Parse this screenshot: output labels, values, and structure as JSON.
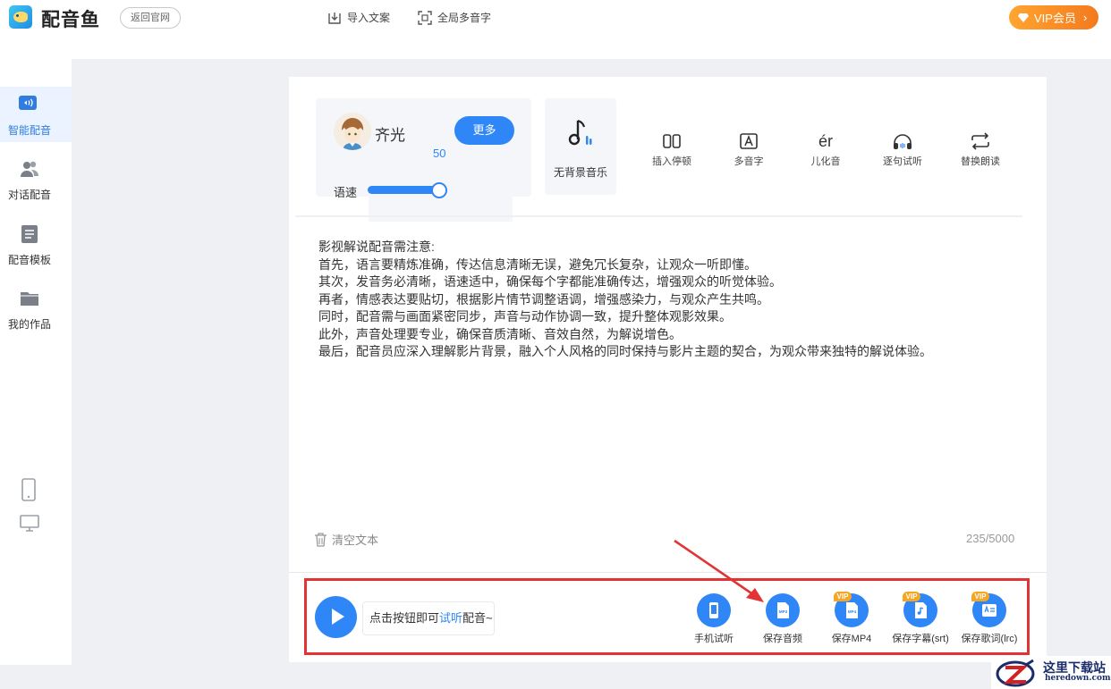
{
  "app": {
    "name": "配音鱼",
    "back_label": "返回官网"
  },
  "top_actions": {
    "import_label": "导入文案",
    "polyphone_label": "全局多音字",
    "vip_label": "VIP会员"
  },
  "sidebar": {
    "items": [
      {
        "label": "智能配音",
        "icon": "speaker-icon"
      },
      {
        "label": "对话配音",
        "icon": "users-icon"
      },
      {
        "label": "配音模板",
        "icon": "template-icon"
      },
      {
        "label": "我的作品",
        "icon": "folder-icon"
      }
    ],
    "devices": [
      "mobile-icon",
      "desktop-icon"
    ]
  },
  "voice": {
    "name": "齐光",
    "more_label": "更多",
    "speed_label": "语速",
    "speed_value": "50",
    "speed_fraction": 0.5
  },
  "music": {
    "label": "无背景音乐"
  },
  "tools": [
    {
      "label": "插入停顿",
      "icon": "pause-insert-icon"
    },
    {
      "label": "多音字",
      "icon": "polyphone-icon"
    },
    {
      "label": "儿化音",
      "icon": "erhua-icon",
      "glyph": "ér"
    },
    {
      "label": "逐句试听",
      "icon": "headphones-icon"
    },
    {
      "label": "替换朗读",
      "icon": "replace-icon"
    }
  ],
  "script_lines": [
    "影视解说配音需注意:",
    "首先，语言要精炼准确，传达信息清晰无误，避免冗长复杂，让观众一听即懂。",
    "其次，发音务必清晰，语速适中，确保每个字都能准确传达，增强观众的听觉体验。",
    "再者，情感表达要贴切，根据影片情节调整语调，增强感染力，与观众产生共鸣。",
    "同时，配音需与画面紧密同步，声音与动作协调一致，提升整体观影效果。",
    "此外，声音处理要专业，确保音质清晰、音效自然，为解说增色。",
    "最后，配音员应深入理解影片背景，融入个人风格的同时保持与影片主题的契合，为观众带来独特的解说体验。"
  ],
  "footer": {
    "clear_label": "清空文本",
    "counter": "235/5000"
  },
  "action_bar": {
    "hint_prefix": "点击按钮即可",
    "hint_highlight": "试听",
    "hint_suffix": "配音~",
    "buttons": [
      {
        "label": "手机试听",
        "icon": "mobile-listen-icon",
        "vip": false
      },
      {
        "label": "保存音频",
        "icon": "mp3-icon",
        "vip": false
      },
      {
        "label": "保存MP4",
        "icon": "mp4-icon",
        "vip": true
      },
      {
        "label": "保存字幕(srt)",
        "icon": "subtitle-icon",
        "vip": true
      },
      {
        "label": "保存歌词(lrc)",
        "icon": "lyrics-icon",
        "vip": true
      }
    ],
    "vip_tag": "VIP",
    "mp3_text": "MP3",
    "mp4_text": "MP4"
  },
  "watermark": {
    "cn": "这里下载站",
    "en": "heredown.com"
  },
  "colors": {
    "accent": "#2f86f6",
    "vip_orange": "#f37a1e",
    "highlight_border": "#e23434",
    "background": "#eef0f3"
  }
}
